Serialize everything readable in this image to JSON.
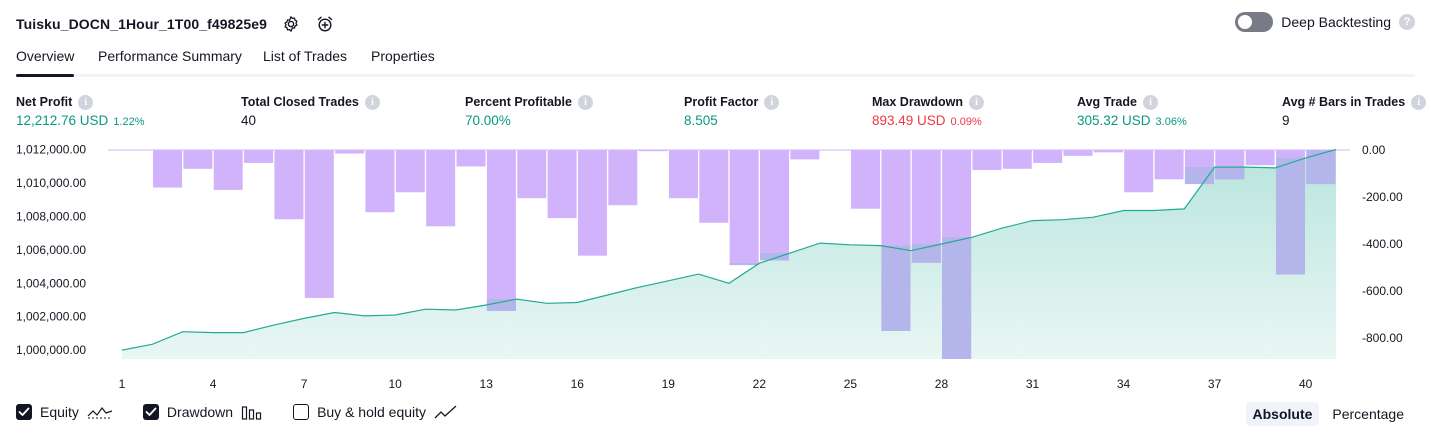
{
  "header": {
    "strategy_name": "Tuisku_DOCN_1Hour_1T00_f49825e9",
    "settings_icon": "gear-icon",
    "alert_icon": "add-alarm-icon",
    "deep_backtesting_label": "Deep Backtesting",
    "deep_backtesting_enabled": false,
    "help_icon": "question-icon"
  },
  "tabs": [
    {
      "label": "Overview",
      "active": true
    },
    {
      "label": "Performance Summary",
      "active": false
    },
    {
      "label": "List of Trades",
      "active": false
    },
    {
      "label": "Properties",
      "active": false
    }
  ],
  "stats": {
    "net_profit": {
      "label": "Net Profit",
      "value": "12,212.76 USD",
      "pct": "1.22%"
    },
    "total_closed_trades": {
      "label": "Total Closed Trades",
      "value": "40"
    },
    "percent_profitable": {
      "label": "Percent Profitable",
      "value": "70.00%"
    },
    "profit_factor": {
      "label": "Profit Factor",
      "value": "8.505"
    },
    "max_drawdown": {
      "label": "Max Drawdown",
      "value": "893.49 USD",
      "pct": "0.09%"
    },
    "avg_trade": {
      "label": "Avg Trade",
      "value": "305.32 USD",
      "pct": "3.06%"
    },
    "avg_bars": {
      "label": "Avg # Bars in Trades",
      "value": "9"
    }
  },
  "colors": {
    "green": "#089981",
    "red": "#f23645",
    "equity_line": "#22ab94",
    "drawdown_bar": "#d1b3fb",
    "overlap_bar": "#b3b5eb"
  },
  "chart_data": {
    "type": "area",
    "x": [
      1,
      2,
      3,
      4,
      5,
      6,
      7,
      8,
      9,
      10,
      11,
      12,
      13,
      14,
      15,
      16,
      17,
      18,
      19,
      20,
      21,
      22,
      23,
      24,
      25,
      26,
      27,
      28,
      29,
      30,
      31,
      32,
      33,
      34,
      35,
      36,
      37,
      38,
      39,
      40,
      41
    ],
    "x_tick_labels": [
      "1",
      "4",
      "7",
      "10",
      "13",
      "16",
      "19",
      "22",
      "25",
      "28",
      "31",
      "34",
      "37",
      "40"
    ],
    "left_axis_ticks": [
      "1,012,000.00",
      "1,010,000.00",
      "1,008,000.00",
      "1,006,000.00",
      "1,004,000.00",
      "1,002,000.00",
      "1,000,000.00"
    ],
    "right_axis_ticks": [
      "0.00",
      "-200.00",
      "-400.00",
      "-600.00",
      "-800.00"
    ],
    "left_ylim": [
      999500,
      1012000
    ],
    "right_ylim": [
      -890,
      0
    ],
    "series": [
      {
        "name": "Equity",
        "axis": "left",
        "values": [
          1000000,
          1000350,
          1001100,
          1001050,
          1001050,
          1001500,
          1001900,
          1002250,
          1002050,
          1002100,
          1002450,
          1002400,
          1002700,
          1003050,
          1002800,
          1002850,
          1003300,
          1003750,
          1004150,
          1004550,
          1004000,
          1005200,
          1005800,
          1006400,
          1006300,
          1006250,
          1005950,
          1006350,
          1006750,
          1007300,
          1007750,
          1007800,
          1007950,
          1008350,
          1008350,
          1008450,
          1010950,
          1010950,
          1010900,
          1011500,
          1012000
        ]
      },
      {
        "name": "Drawdown",
        "axis": "right",
        "values": [
          0,
          -160,
          -80,
          -170,
          -55,
          -295,
          -630,
          -15,
          -265,
          -180,
          -325,
          -70,
          -685,
          -205,
          -290,
          -450,
          -235,
          -5,
          -205,
          -310,
          -490,
          -470,
          -40,
          0,
          -250,
          -770,
          -480,
          -890,
          -85,
          -80,
          -55,
          -25,
          -10,
          -180,
          -125,
          -145,
          -125,
          -65,
          -530,
          -145,
          0
        ]
      }
    ]
  },
  "legend": {
    "equity_label": "Equity",
    "equity_checked": true,
    "drawdown_label": "Drawdown",
    "drawdown_checked": true,
    "buyhold_label": "Buy & hold equity",
    "buyhold_checked": false
  },
  "modes": {
    "absolute": "Absolute",
    "percentage": "Percentage",
    "active": "absolute"
  }
}
